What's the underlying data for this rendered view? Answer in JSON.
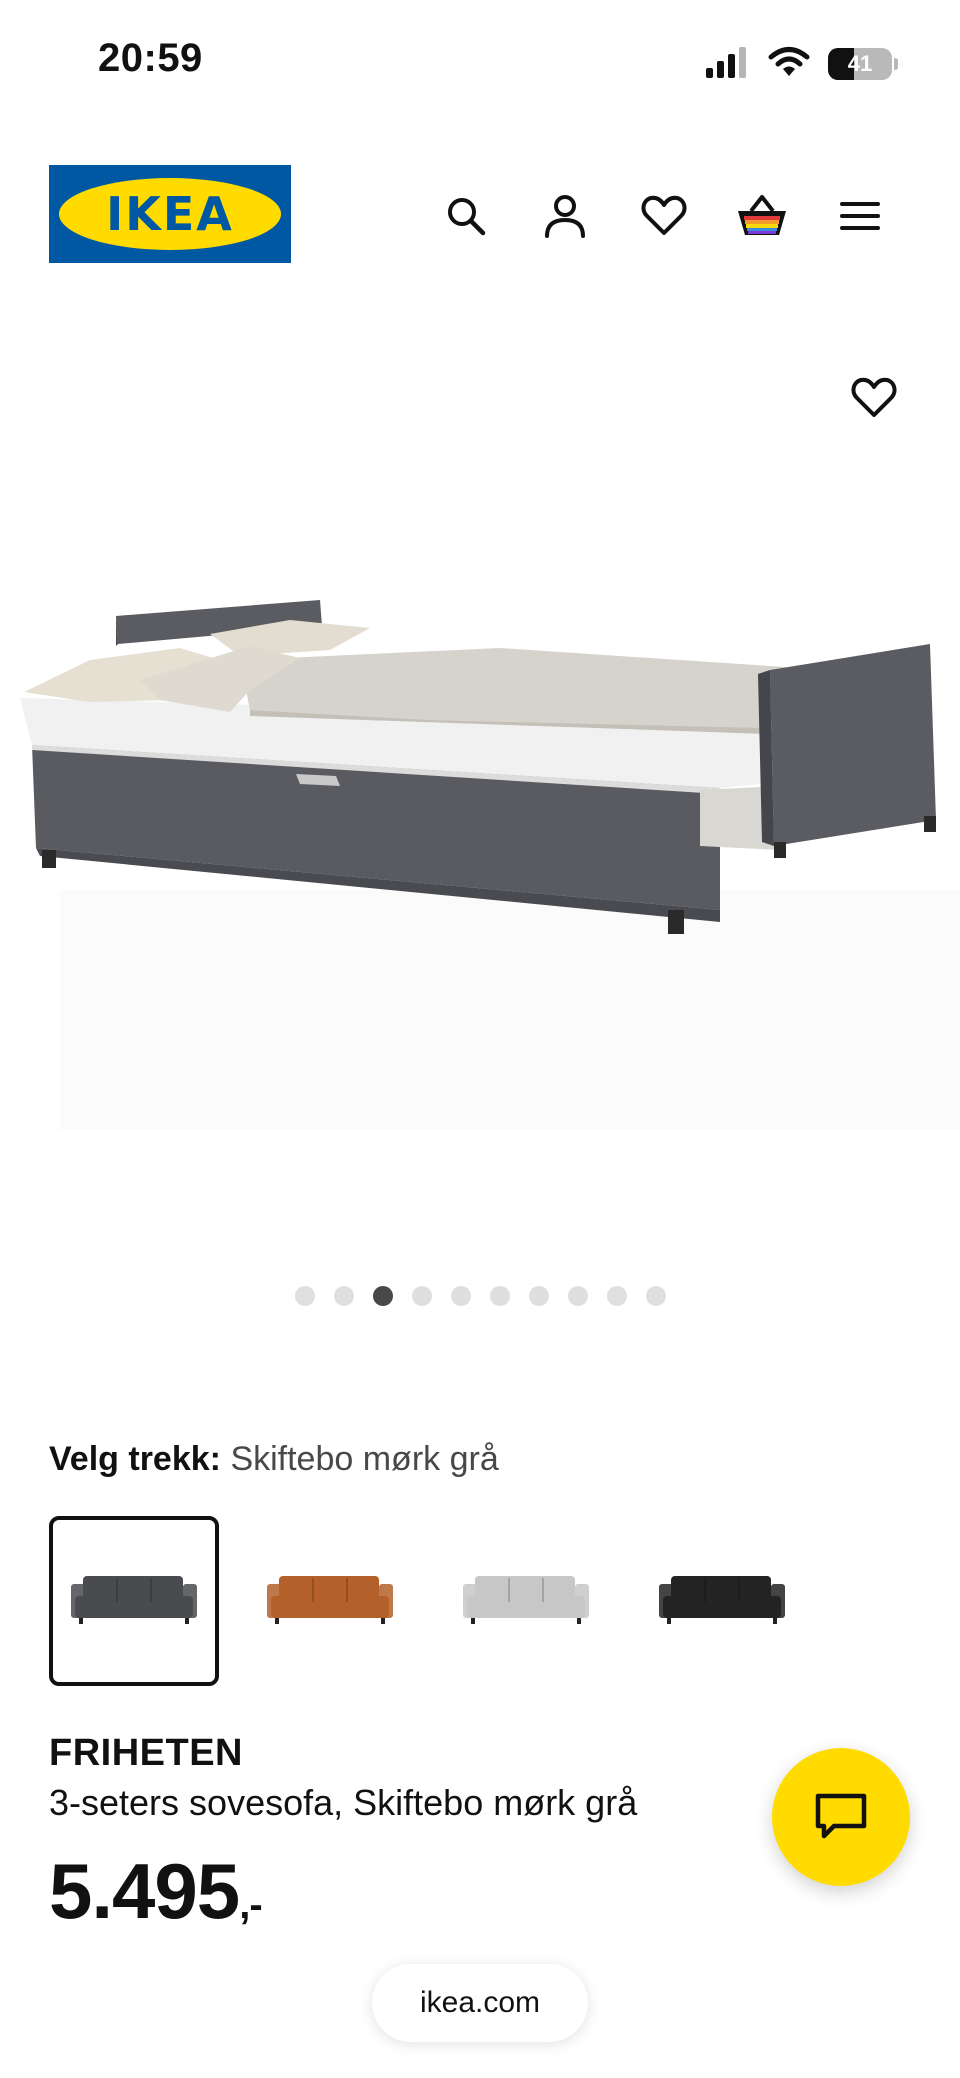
{
  "status_bar": {
    "time": "20:59",
    "battery": "41",
    "battery_level": 0.41,
    "icons": [
      "signal-icon",
      "wifi-icon",
      "battery-icon"
    ]
  },
  "header": {
    "logo_text": "IKEA",
    "icons": [
      "search-icon",
      "account-icon",
      "heart-icon",
      "basket-icon",
      "menu-icon"
    ]
  },
  "gallery": {
    "image_count": 10,
    "active_index": 2
  },
  "cover": {
    "label": "Velg trekk:",
    "value": "Skiftebo mørk grå",
    "swatches": [
      {
        "color": "#4a4b4f",
        "selected": true
      },
      {
        "color": "#b4602a",
        "selected": false
      },
      {
        "color": "#c7c7c7",
        "selected": false
      },
      {
        "color": "#232323",
        "selected": false
      }
    ]
  },
  "product": {
    "name": "FRIHETEN",
    "description": "3-seters sovesofa, Skiftebo mørk grå",
    "price": "5.495",
    "price_suffix": ",-"
  },
  "browser": {
    "url": "ikea.com"
  },
  "colors": {
    "ikea_blue": "#0058a3",
    "ikea_yellow": "#ffdb00"
  }
}
